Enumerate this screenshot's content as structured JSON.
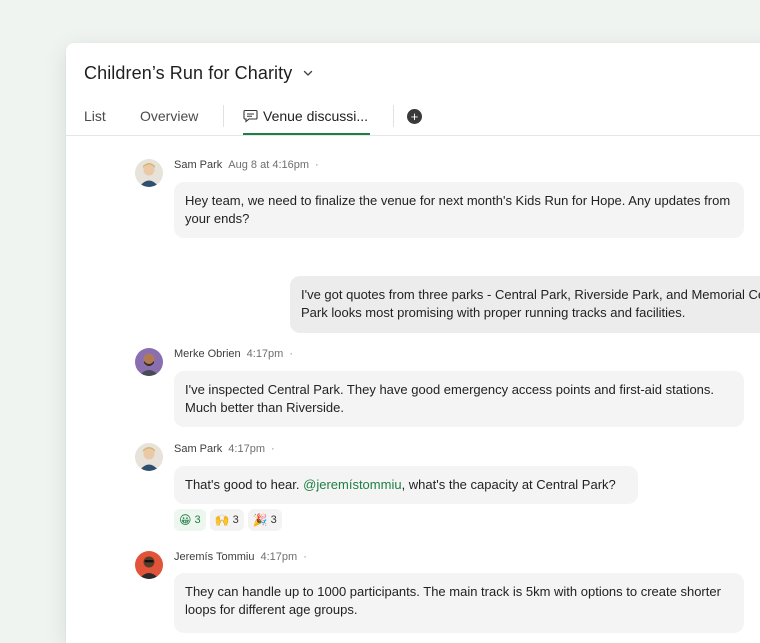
{
  "header": {
    "title": "Children’s Run for Charity"
  },
  "tabs": [
    {
      "label": "List"
    },
    {
      "label": "Overview"
    },
    {
      "label": "Venue discussi..."
    }
  ],
  "add_tab_symbol": "+",
  "messages": [
    {
      "author": "Sam Park",
      "time": "Aug 8 at 4:16pm",
      "dot": "·",
      "text": "Hey team, we need to finalize the venue for next month's Kids Run for Hope. Any updates from your ends?"
    },
    {
      "own": true,
      "text": "I've got quotes from three parks - Central Park, Riverside Park, and Memorial Central Park looks most promising with proper running tracks and facilities."
    },
    {
      "author": "Merke Obrien",
      "time": "4:17pm",
      "dot": "·",
      "text": "I've inspected Central Park. They have good emergency access points and first-aid stations. Much better than Riverside."
    },
    {
      "author": "Sam Park",
      "time": "4:17pm",
      "dot": "·",
      "text_before": "That's good to hear. ",
      "mention": "@jeremístommiu",
      "text_after": ", what's the capacity at Central Park?",
      "reactions": [
        {
          "emoji": "😀",
          "count": "3"
        },
        {
          "emoji": "🙌",
          "count": "3"
        },
        {
          "emoji": "🎉",
          "count": "3"
        }
      ]
    },
    {
      "author": "Jeremís Tommiu",
      "time": "4:17pm",
      "dot": "·",
      "text": "They can handle up to 1000 participants. The main track is 5km with options to create shorter loops for different age groups."
    }
  ],
  "colors": {
    "accent": "#1e7f43",
    "background": "#eff4f1"
  }
}
